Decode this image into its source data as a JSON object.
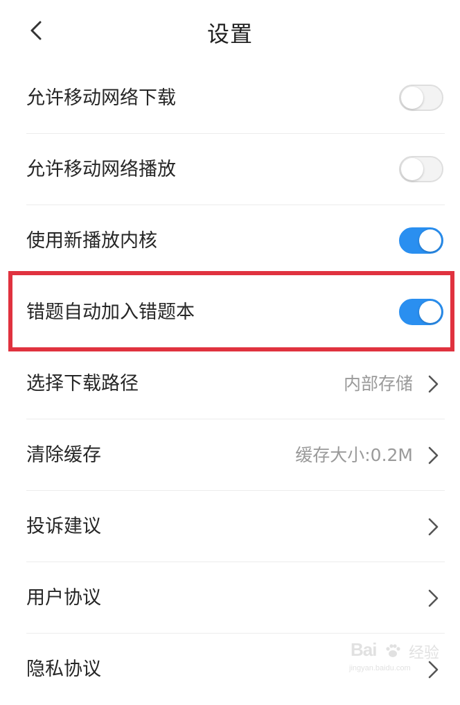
{
  "header": {
    "title": "设置",
    "back_icon": "chevron-left-icon"
  },
  "settings": [
    {
      "label": "允许移动网络下载",
      "type": "toggle",
      "on": false
    },
    {
      "label": "允许移动网络播放",
      "type": "toggle",
      "on": false
    },
    {
      "label": "使用新播放内核",
      "type": "toggle",
      "on": true
    },
    {
      "label": "错题自动加入错题本",
      "type": "toggle",
      "on": true,
      "highlighted": true
    },
    {
      "label": "选择下载路径",
      "type": "link",
      "value": "内部存储"
    },
    {
      "label": "清除缓存",
      "type": "link",
      "value": "缓存大小:0.2M"
    },
    {
      "label": "投诉建议",
      "type": "link"
    },
    {
      "label": "用户协议",
      "type": "link"
    },
    {
      "label": "隐私协议",
      "type": "link"
    }
  ],
  "colors": {
    "toggle_on": "#2a8ff0",
    "toggle_off": "#f3f3f3",
    "highlight_border": "#e0323f"
  },
  "watermark": {
    "brand": "Bai",
    "suffix": "经验",
    "url": "jingyan.baidu.com"
  }
}
